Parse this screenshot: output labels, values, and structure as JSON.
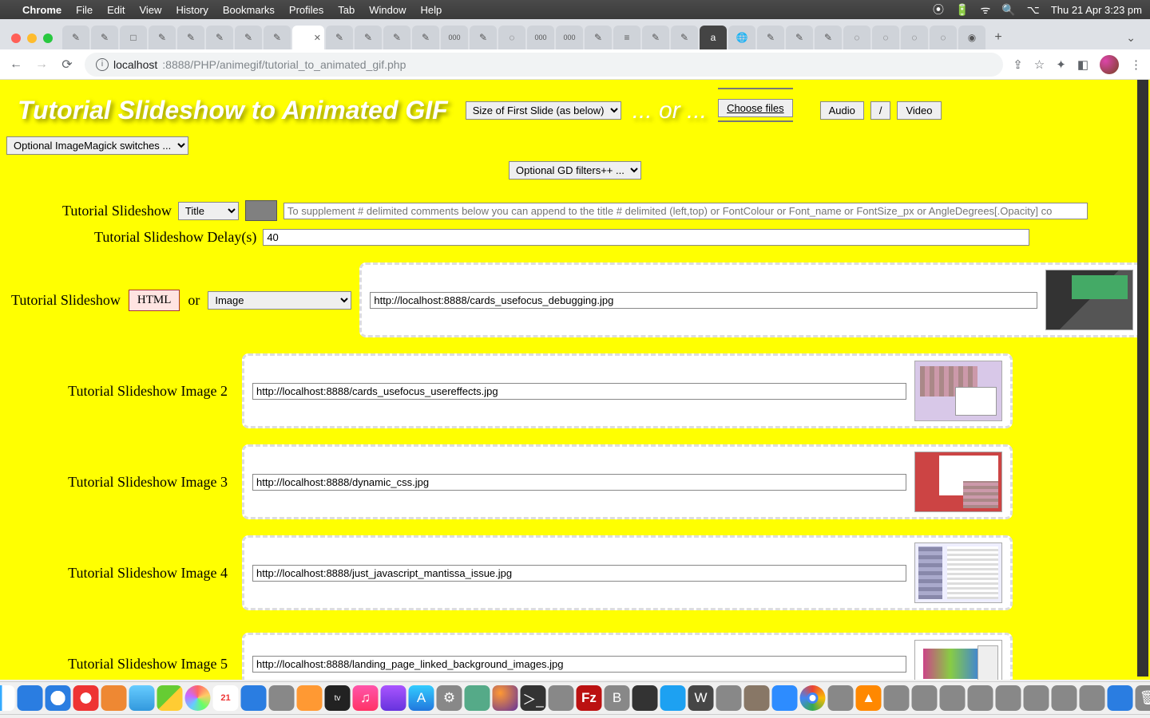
{
  "menubar": {
    "app": "Chrome",
    "items": [
      "File",
      "Edit",
      "View",
      "History",
      "Bookmarks",
      "Profiles",
      "Tab",
      "Window",
      "Help"
    ],
    "datetime": "Thu 21 Apr  3:23 pm"
  },
  "chrome": {
    "url_host_prefix": "localhost",
    "url_port_path": ":8888/PHP/animegif/tutorial_to_animated_gif.php"
  },
  "page": {
    "title": "Tutorial Slideshow to Animated GIF",
    "size_select": "Size of First Slide (as below)",
    "or_text": "... or ...",
    "choose_files": "Choose files",
    "audio_btn": "Audio",
    "slash_btn": "/",
    "video_btn": "Video",
    "imagemagick_select": "Optional ImageMagick switches ...",
    "gd_filters_select": "Optional GD filters++ ...",
    "ts_label": "Tutorial Slideshow",
    "title_select": "Title",
    "title_placeholder": "To supplement # delimited comments below you can append to the title # delimited (left,top) or FontColour or Font_name or FontSize_px or AngleDegrees[.Opacity] co",
    "delay_label": "Tutorial Slideshow Delay(s)",
    "delay_value": "40",
    "row1": {
      "label": "Tutorial Slideshow",
      "html_btn": "HTML",
      "or": "or",
      "img_select": "Image",
      "url": "http://localhost:8888/cards_usefocus_debugging.jpg"
    },
    "rows": [
      {
        "label": "Tutorial Slideshow Image 2",
        "url": "http://localhost:8888/cards_usefocus_usereffects.jpg"
      },
      {
        "label": "Tutorial Slideshow Image 3",
        "url": "http://localhost:8888/dynamic_css.jpg"
      },
      {
        "label": "Tutorial Slideshow Image 4",
        "url": "http://localhost:8888/just_javascript_mantissa_issue.jpg"
      },
      {
        "label": "Tutorial Slideshow Image 5",
        "url": "http://localhost:8888/landing_page_linked_background_images.jpg"
      }
    ]
  }
}
